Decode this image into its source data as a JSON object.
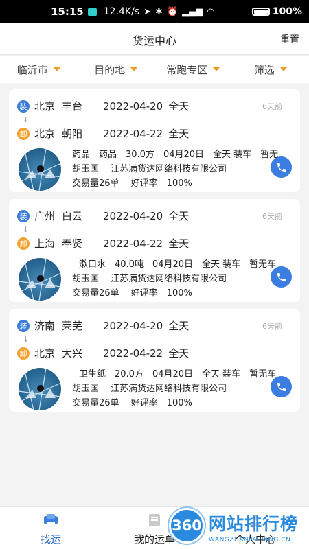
{
  "status_bar": {
    "time": "15:15",
    "speed": "12.4K/s",
    "battery": "100%"
  },
  "header": {
    "title": "货运中心",
    "reset": "重置"
  },
  "filters": [
    {
      "label": "临沂市"
    },
    {
      "label": "目的地"
    },
    {
      "label": "常跑专区"
    },
    {
      "label": "筛选"
    }
  ],
  "colors": {
    "accent": "#3b7de0",
    "caret": "#f09a1f",
    "load_tag": "#3c7dd9",
    "unload_tag": "#f0a330"
  },
  "cards": [
    {
      "origin": {
        "tag": "装",
        "city": "北京",
        "district": "丰台",
        "date": "2022-04-20",
        "time": "全天"
      },
      "dest": {
        "tag": "卸",
        "city": "北京",
        "district": "朝阳",
        "date": "2022-04-22",
        "time": "全天"
      },
      "age": "6天前",
      "connector": "↓",
      "goods": "药品　药品　30.0方　04月20日　全天 装车　暂无",
      "shipper": "胡玉国　 江苏满货达网络科技有限公司",
      "stats": "交易量26单　 好评率　100%"
    },
    {
      "origin": {
        "tag": "装",
        "city": "广州",
        "district": "白云",
        "date": "2022-04-20",
        "time": "全天"
      },
      "dest": {
        "tag": "卸",
        "city": "上海",
        "district": "奉贤",
        "date": "2022-04-22",
        "time": "全天"
      },
      "age": "6天前",
      "connector": "↓",
      "goods": "漱口水　40.0吨　04月20日　全天 装车　暂无车",
      "shipper": "胡玉国　 江苏满货达网络科技有限公司",
      "stats": "交易量26单　 好评率　100%"
    },
    {
      "origin": {
        "tag": "装",
        "city": "济南",
        "district": "莱芜",
        "date": "2022-04-20",
        "time": "全天"
      },
      "dest": {
        "tag": "卸",
        "city": "北京",
        "district": "大兴",
        "date": "2022-04-22",
        "time": "全天"
      },
      "age": "6天前",
      "connector": "↓",
      "goods": "卫生纸　20.0方　04月20日　全天 装车　暂无车",
      "shipper": "胡玉国　 江苏满货达网络科技有限公司",
      "stats": "交易量26单　 好评率　100%"
    }
  ],
  "bottom_nav": [
    {
      "label": "找运",
      "icon": "truck-icon",
      "active": true
    },
    {
      "label": "我的运单",
      "icon": "waybill-icon",
      "active": false
    },
    {
      "label": "个人中心",
      "icon": "user-icon",
      "active": false
    }
  ],
  "watermark": {
    "badge": "360",
    "title": "网站排行榜",
    "sub": "WANGZHANPAIHANG.CN"
  }
}
